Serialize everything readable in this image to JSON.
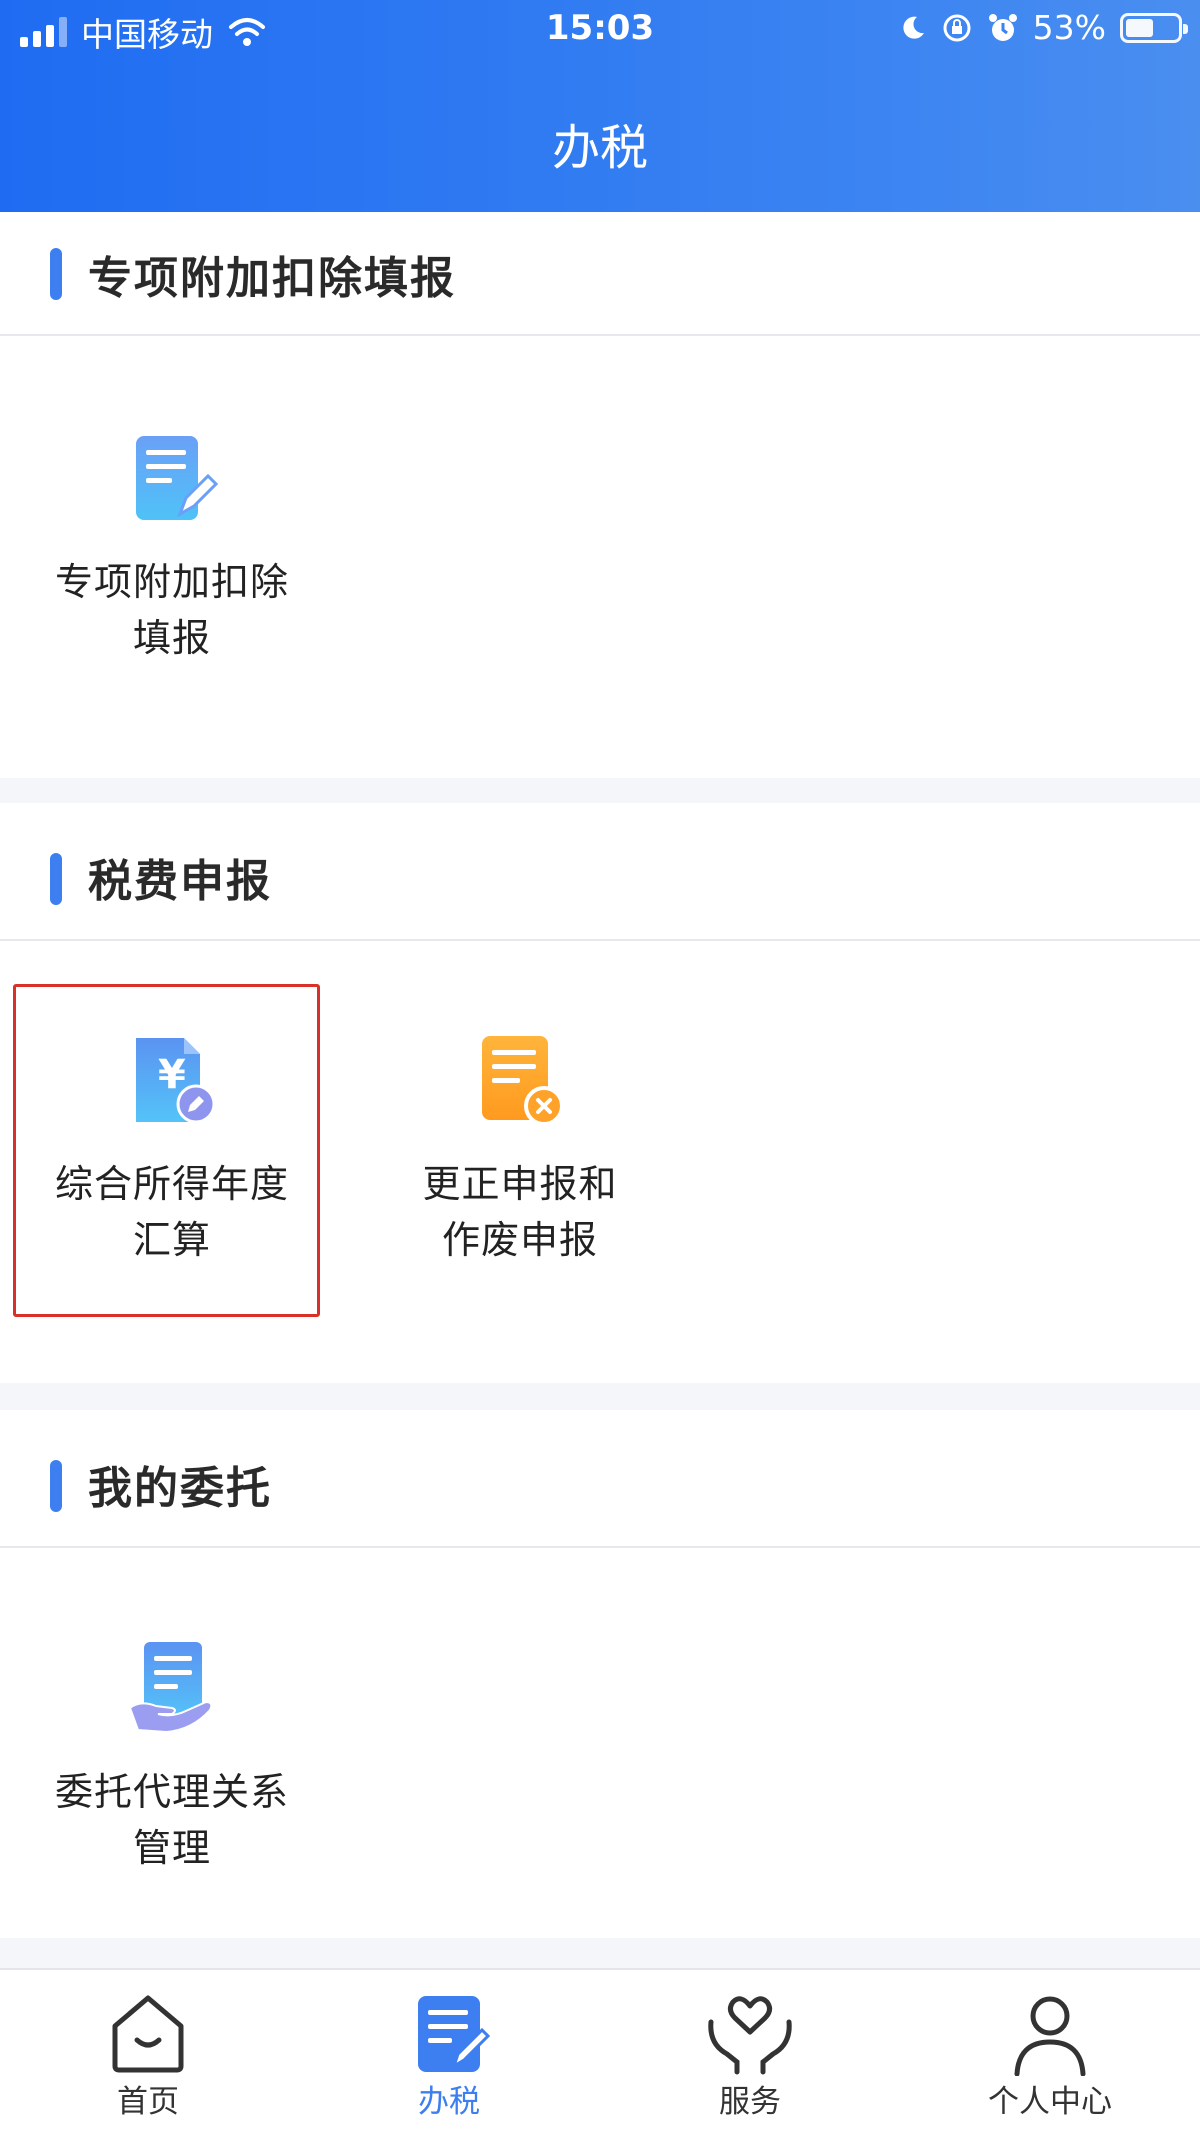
{
  "status_bar": {
    "carrier": "中国移动",
    "time": "15:03",
    "battery": "53%",
    "battery_level": 0.53
  },
  "header": {
    "title": "办税"
  },
  "sections": [
    {
      "title": "专项附加扣除填报",
      "items": [
        {
          "label_line1": "专项附加扣除",
          "label_line2": "填报",
          "icon": "document-edit-icon"
        }
      ]
    },
    {
      "title": "税费申报",
      "items": [
        {
          "label_line1": "综合所得年度",
          "label_line2": "汇算",
          "icon": "yuan-document-icon",
          "highlighted": true
        },
        {
          "label_line1": "更正申报和",
          "label_line2": "作废申报",
          "icon": "document-cancel-icon"
        }
      ]
    },
    {
      "title": "我的委托",
      "items": [
        {
          "label_line1": "委托代理关系",
          "label_line2": "管理",
          "icon": "document-hand-icon"
        }
      ]
    }
  ],
  "tabbar": {
    "items": [
      {
        "label": "首页",
        "icon": "home-icon",
        "active": false
      },
      {
        "label": "办税",
        "icon": "tax-document-icon",
        "active": true
      },
      {
        "label": "服务",
        "icon": "heart-hands-icon",
        "active": false
      },
      {
        "label": "个人中心",
        "icon": "person-icon",
        "active": false
      }
    ]
  },
  "colors": {
    "accent": "#3d7ff0",
    "header_gradient_start": "#1f6cf2",
    "highlight_border": "#d9302a",
    "orange_icon": "#ffa22a"
  }
}
